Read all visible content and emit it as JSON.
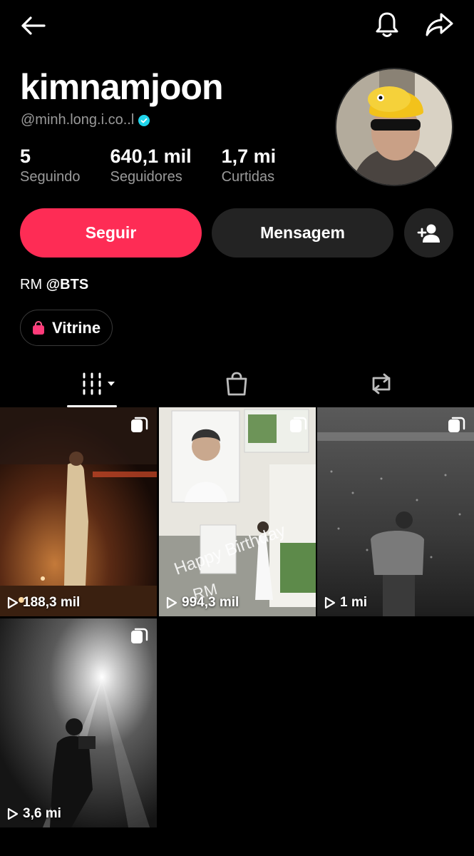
{
  "profile": {
    "name": "kimnamjoon",
    "handle": "@minh.long.i.co..l",
    "stats": [
      {
        "value": "5",
        "label": "Seguindo"
      },
      {
        "value": "640,1 mil",
        "label": "Seguidores"
      },
      {
        "value": "1,7 mi",
        "label": "Curtidas"
      }
    ],
    "bio_prefix": "RM ",
    "bio_mention": "@BTS"
  },
  "actions": {
    "follow_label": "Seguir",
    "message_label": "Mensagem"
  },
  "vitrine_label": "Vitrine",
  "colors": {
    "accent": "#fe2c55",
    "button_dark": "#232323",
    "muted_text": "#9a9a9a",
    "verified": "#20d5ec"
  },
  "tiles": [
    {
      "views": "188,3 mil",
      "multi": true
    },
    {
      "views": "994,3 mil",
      "multi": true
    },
    {
      "views": "1 mi",
      "multi": true
    },
    {
      "views": "3,6 mi",
      "multi": true
    }
  ]
}
